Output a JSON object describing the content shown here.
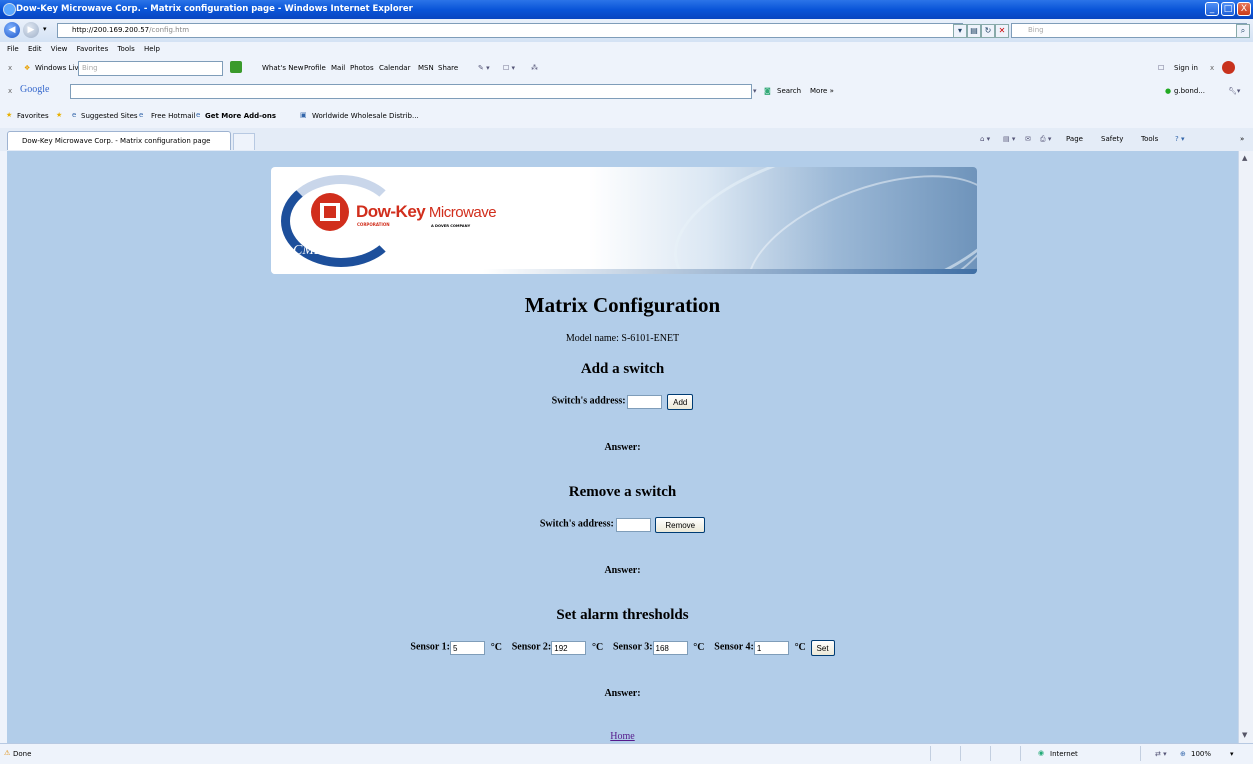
{
  "window": {
    "title": "Dow-Key Microwave Corp. - Matrix configuration page - Windows Internet Explorer",
    "minimize_glyph": "_",
    "maximize_glyph": "□",
    "close_glyph": "X"
  },
  "address_bar": {
    "host": "http://200.169.200.57",
    "path": "/config.htm",
    "search_placeholder": "Bing"
  },
  "menu": [
    "File",
    "Edit",
    "View",
    "Favorites",
    "Tools",
    "Help"
  ],
  "windows_live_toolbar": {
    "brand": "Windows Live",
    "search_placeholder": "Bing",
    "links": [
      "What's New",
      "Profile",
      "Mail",
      "Photos",
      "Calendar",
      "MSN",
      "Share"
    ],
    "sign_in": "Sign in"
  },
  "google_toolbar": {
    "brand": "Google",
    "search_button": "Search",
    "more": "More »",
    "account": "g.bond..."
  },
  "favorites_bar": {
    "favorites": "Favorites",
    "items": [
      "Suggested Sites",
      "Free Hotmail",
      "Get More Add-ons",
      "Worldwide Wholesale Distrib..."
    ]
  },
  "tabs": {
    "active": "Dow-Key Microwave Corp. - Matrix configuration page",
    "commands": [
      "Page",
      "Safety",
      "Tools"
    ]
  },
  "banner": {
    "brand_main": "Dow-Key",
    "brand_sub": " Microwave",
    "corporation": "CORPORATION",
    "dover": "A  DOVER  COMPANY",
    "cmp": "CMP"
  },
  "page": {
    "heading": "Matrix Configuration",
    "model_label": "Model name: S-6101-ENET",
    "add": {
      "heading": "Add a switch",
      "address_label": "Switch's address:",
      "address_value": "",
      "button": "Add",
      "answer": "Answer:"
    },
    "remove": {
      "heading": "Remove a switch",
      "address_label": "Switch's address:",
      "address_value": "",
      "button": "Remove",
      "answer": "Answer:"
    },
    "alarm": {
      "heading": "Set alarm thresholds",
      "sensors": [
        {
          "label": "Sensor 1:",
          "value": "5",
          "unit": "°C"
        },
        {
          "label": "Sensor 2:",
          "value": "192",
          "unit": "°C"
        },
        {
          "label": "Sensor 3:",
          "value": "168",
          "unit": "°C"
        },
        {
          "label": "Sensor 4:",
          "value": "1",
          "unit": "°C"
        }
      ],
      "button": "Set",
      "answer": "Answer:"
    },
    "home_link": "Home"
  },
  "status_bar": {
    "status": "Done",
    "zone": "Internet",
    "zoom": "100%"
  },
  "colors": {
    "page_background": "#b2cde9",
    "link": "#551a8b",
    "brand_red": "#d12e1c",
    "brand_blue": "#1d4f9b"
  }
}
